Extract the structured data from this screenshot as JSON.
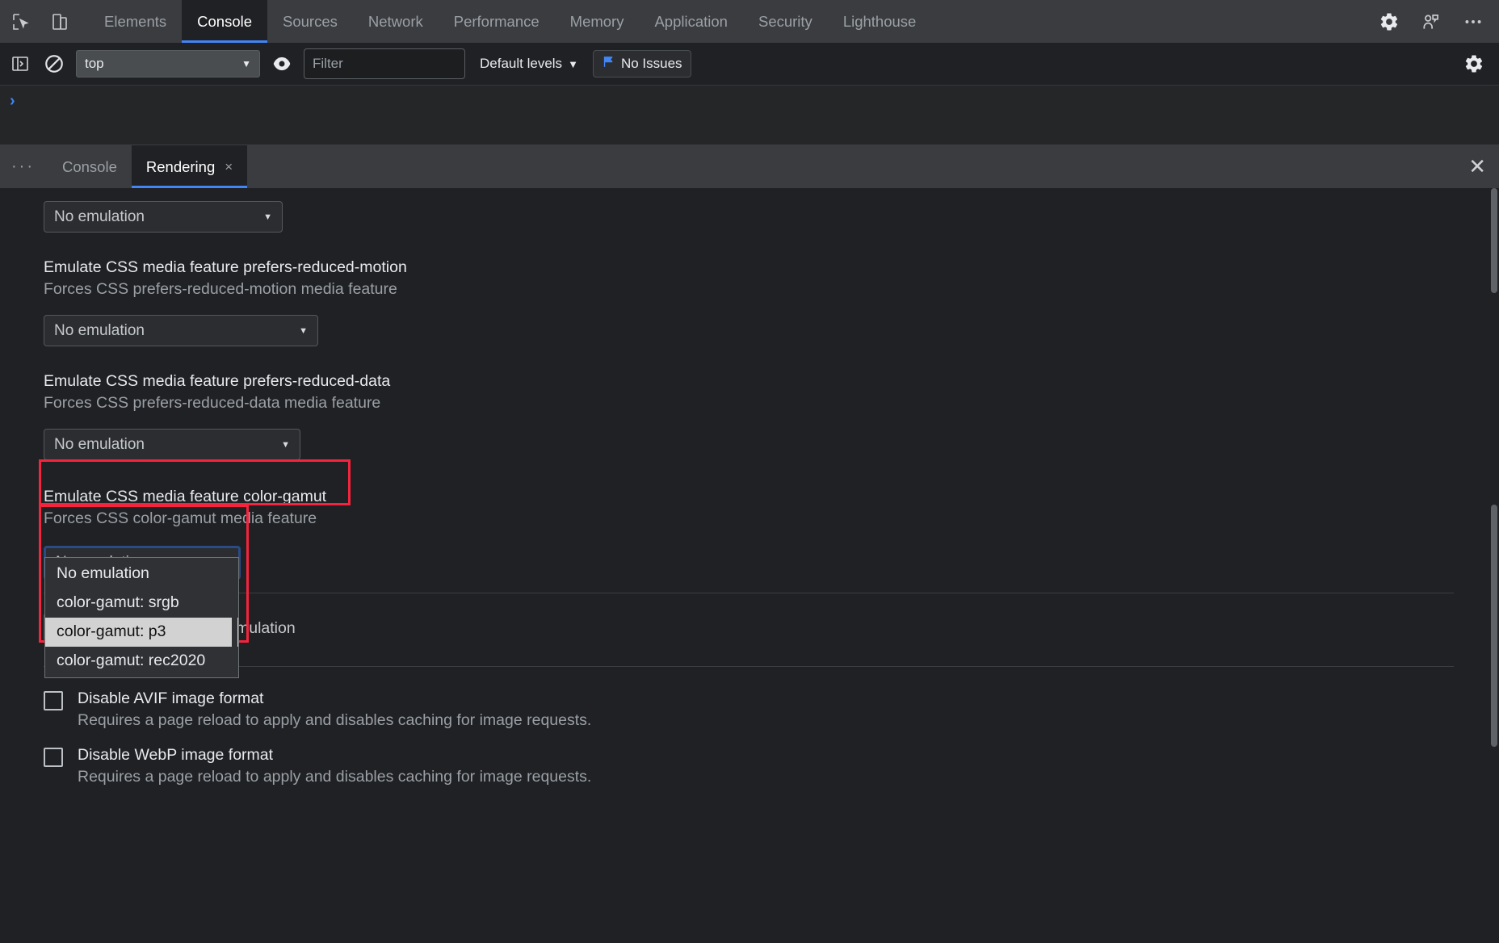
{
  "topbar": {
    "icons": [
      {
        "name": "inspect-element-icon"
      },
      {
        "name": "device-toolbar-icon"
      }
    ],
    "tabs": [
      {
        "label": "Elements",
        "active": false
      },
      {
        "label": "Console",
        "active": true
      },
      {
        "label": "Sources",
        "active": false
      },
      {
        "label": "Network",
        "active": false
      },
      {
        "label": "Performance",
        "active": false
      },
      {
        "label": "Memory",
        "active": false
      },
      {
        "label": "Application",
        "active": false
      },
      {
        "label": "Security",
        "active": false
      },
      {
        "label": "Lighthouse",
        "active": false
      }
    ],
    "right_icons": [
      {
        "name": "settings-gear-icon"
      },
      {
        "name": "user-profile-icon"
      },
      {
        "name": "more-options-icon"
      }
    ]
  },
  "console_toolbar": {
    "sidebar_toggle": "console-sidebar-icon",
    "clear_console": "clear-console-icon",
    "context_value": "top",
    "eye_icon": "live-expression-icon",
    "filter_placeholder": "Filter",
    "filter_value": "",
    "levels_label": "Default levels",
    "issues_label": "No Issues",
    "settings_icon": "console-settings-gear-icon"
  },
  "console_view": {
    "prompt": "›"
  },
  "drawer": {
    "more_label": "···",
    "tabs": [
      {
        "label": "Console",
        "active": false,
        "closable": false
      },
      {
        "label": "Rendering",
        "active": true,
        "closable": true,
        "close_glyph": "×"
      }
    ],
    "close_glyph": "✕"
  },
  "rendering": {
    "accent_color": "#4285f4",
    "highlight_color": "#f4243e",
    "focus_color": "#2a4b85",
    "top_select_value": "No emulation",
    "settings": [
      {
        "title": "Emulate CSS media feature prefers-reduced-motion",
        "subtitle": "Forces CSS prefers-reduced-motion media feature",
        "select_value": "No emulation"
      },
      {
        "title": "Emulate CSS media feature prefers-reduced-data",
        "subtitle": "Forces CSS prefers-reduced-data media feature",
        "select_value": "No emulation"
      },
      {
        "title": "Emulate CSS media feature color-gamut",
        "subtitle": "Forces CSS color-gamut media feature",
        "select_value": "No emulation"
      }
    ],
    "occluded_text": "mulation",
    "bottom_select_value": "No emulation",
    "dropdown_options": [
      {
        "label": "No emulation",
        "selected": false
      },
      {
        "label": "color-gamut: srgb",
        "selected": false
      },
      {
        "label": "color-gamut: p3",
        "selected": true
      },
      {
        "label": "color-gamut: rec2020",
        "selected": false
      }
    ],
    "checkboxes": [
      {
        "title": "Disable AVIF image format",
        "subtitle": "Requires a page reload to apply and disables caching for image requests.",
        "checked": false
      },
      {
        "title": "Disable WebP image format",
        "subtitle": "Requires a page reload to apply and disables caching for image requests.",
        "checked": false
      }
    ]
  }
}
